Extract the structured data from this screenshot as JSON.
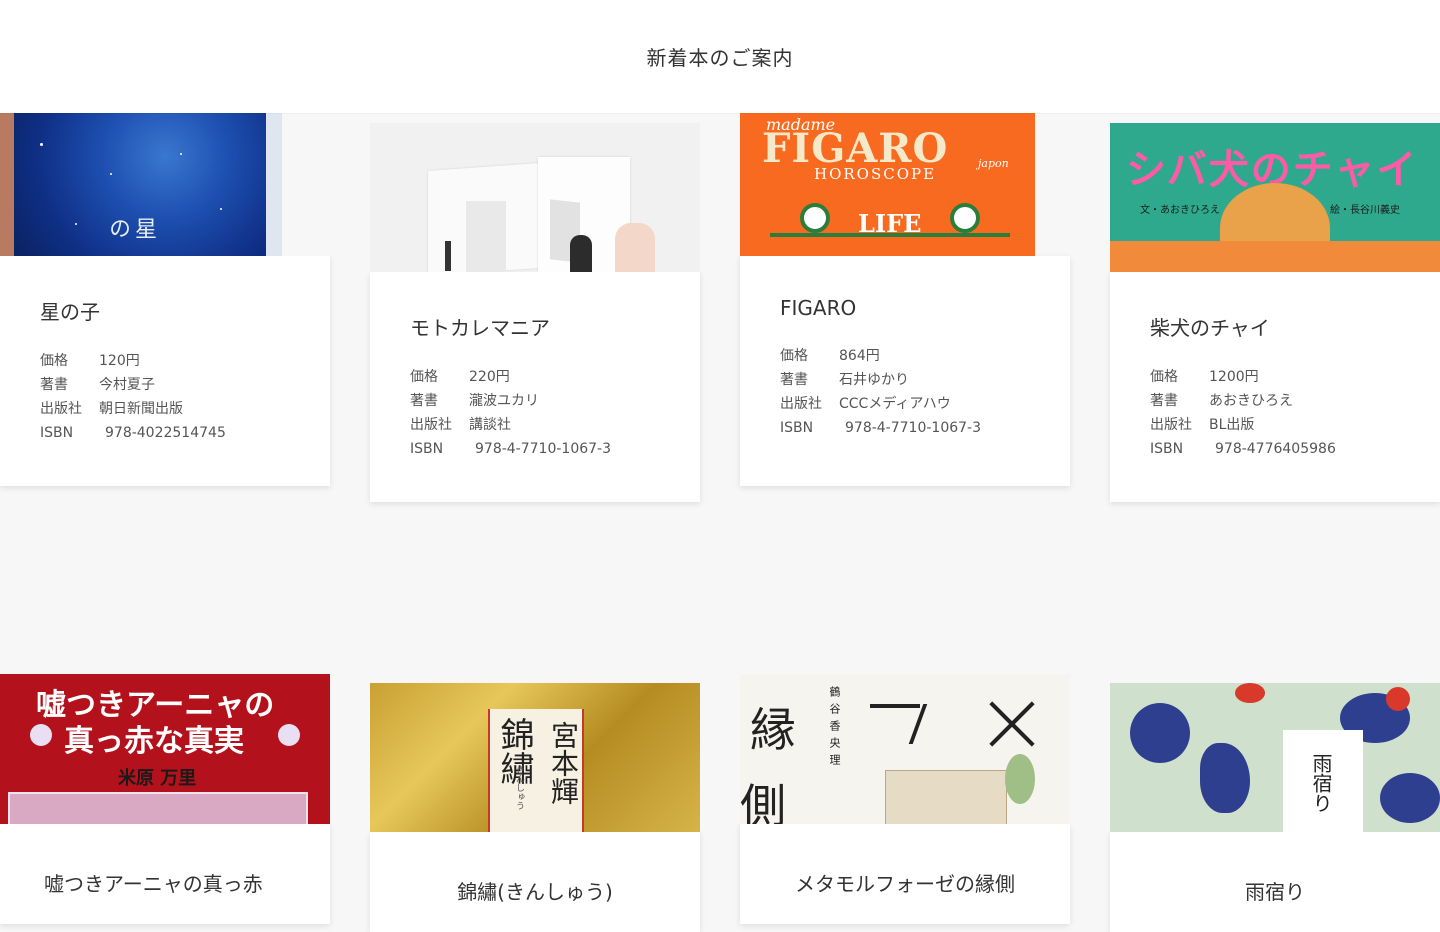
{
  "header": {
    "title": "新着本のご案内"
  },
  "labels": {
    "price": "価格",
    "author": "著書",
    "publisher": "出版社",
    "isbn": "ISBN"
  },
  "books": [
    {
      "title": "星の子",
      "price": "120円",
      "author": "今村夏子",
      "publisher": "朝日新聞出版",
      "isbn": "978-4022514745",
      "cover_text": "星の"
    },
    {
      "title": "モトカレマニア",
      "price": "220円",
      "author": "瀧波ユカリ",
      "publisher": "講談社",
      "isbn": "978-4-7710-1067-3"
    },
    {
      "title": "FIGARO",
      "price": "864円",
      "author": "石井ゆかり",
      "publisher": "CCCメディアハウ",
      "isbn": "978-4-7710-1067-3",
      "cover_text": {
        "top": "madame",
        "main": "FIGARO",
        "sub": "HOROSCOPE",
        "life": "LIFE",
        "japon": "japon"
      }
    },
    {
      "title": "柴犬のチャイ",
      "price": "1200円",
      "author": "あおきひろえ",
      "publisher": "BL出版",
      "isbn": "978-4776405986",
      "cover_text": {
        "main": "シバ犬のチャイ",
        "left": "文・あおきひろえ",
        "right": "絵・長谷川義史"
      }
    },
    {
      "title": "嘘つきアーニャの真っ赤",
      "cover_text": {
        "line1": "嘘つきアーニャの",
        "line2": "真っ赤な真実",
        "author": "米原 万里"
      }
    },
    {
      "title": "錦繡(きんしゅう)",
      "cover_text": {
        "title": "錦繡",
        "author": "宮本輝",
        "ruby": "きんしゅう"
      }
    },
    {
      "title": "メタモルフォーゼの縁側",
      "cover_text": {
        "author": "鶴谷香央理",
        "k1": "縁",
        "k2": "側"
      }
    },
    {
      "title": "雨宿り",
      "cover_text": {
        "title": "雨宿り"
      }
    }
  ],
  "colors": {
    "background": "#f7f7f7",
    "card": "#ffffff",
    "text": "#333333",
    "figaro_orange": "#f86a1f",
    "shiba_teal": "#2fa98e",
    "anya_red": "#b3121c"
  }
}
